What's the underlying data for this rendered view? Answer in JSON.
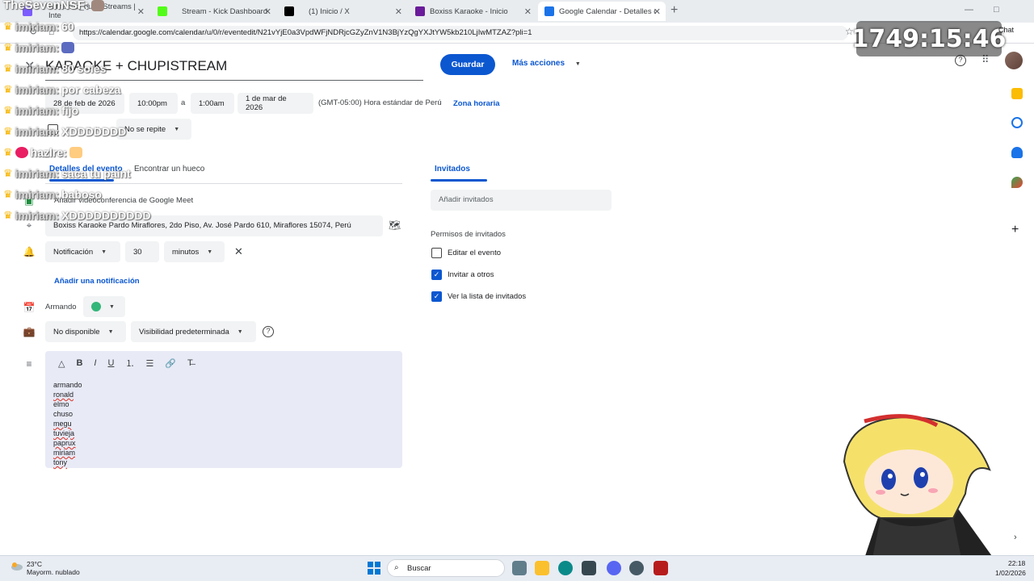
{
  "browser": {
    "tabs": [
      {
        "label": "Armando_ouo | Streams | Inte",
        "color": "#7b5cff"
      },
      {
        "label": "Stream - Kick Dashboard",
        "color": "#53fc18"
      },
      {
        "label": "(1) Inicio / X",
        "color": "#000000"
      },
      {
        "label": "Boxiss Karaoke - Inicio",
        "color": "#6a1b9a"
      },
      {
        "label": "Google Calendar - Detalles del eve",
        "color": "#1a73e8"
      }
    ],
    "url": "https://calendar.google.com/calendar/u/0/r/eventedit/N21vYjE0a3VpdWFjNDRjcGZyZnV1N3BjYzQgYXJtYW5kb210LjIwMTZAZ?pli=1"
  },
  "event": {
    "title": "KARAOKE + CHUPISTREAM",
    "save_label": "Guardar",
    "more_actions_label": "Más acciones",
    "start_date": "28 de feb de 2026",
    "start_time": "10:00pm",
    "to_label": "a",
    "end_time": "1:00am",
    "end_date": "1 de mar de 2026",
    "timezone": "(GMT-05:00) Hora estándar de Perú",
    "timezone_link": "Zona horaria",
    "repeat": "No se repite",
    "all_day_label": "Todo el día"
  },
  "details": {
    "tab_details": "Detalles del evento",
    "tab_find_slot": "Encontrar un hueco",
    "meet_label": "Añadir videoconferencia de Google Meet",
    "location": "Boxiss Karaoke Pardo Miraflores, 2do Piso, Av. José Pardo 610, Miraflores 15074, Perú",
    "notification_type": "Notificación",
    "notification_value": "30",
    "notification_unit": "minutos",
    "add_notification": "Añadir una notificación",
    "calendar_owner": "Armando",
    "calendar_color": "#33b679",
    "availability": "No disponible",
    "visibility": "Visibilidad predeterminada",
    "description_lines": [
      "armando",
      "ronald",
      "elmo",
      "chuso",
      "megu",
      "tuvieja",
      "paprux",
      "miriam",
      "tony"
    ]
  },
  "guests": {
    "tab_label": "Invitados",
    "add_placeholder": "Añadir invitados",
    "permissions_title": "Permisos de invitados",
    "permissions": [
      {
        "label": "Editar el evento",
        "checked": false
      },
      {
        "label": "Invitar a otros",
        "checked": true
      },
      {
        "label": "Ver la lista de invitados",
        "checked": true
      }
    ]
  },
  "overlay": {
    "timer": "1749:15:46",
    "chat_label": "Chat",
    "chat": [
      {
        "user": "TheSevenNSF:",
        "msg": ""
      },
      {
        "user": "imiriam:",
        "msg": "60"
      },
      {
        "user": "imiriam:",
        "msg": ""
      },
      {
        "user": "imiriam:",
        "msg": "80 soles"
      },
      {
        "user": "imiriam:",
        "msg": "por cabeza"
      },
      {
        "user": "imiriam:",
        "msg": "fijo"
      },
      {
        "user": "imiriam:",
        "msg": "XDDDDDDD"
      },
      {
        "user": "hazlre:",
        "msg": ""
      },
      {
        "user": "imiriam:",
        "msg": "saca tu paint"
      },
      {
        "user": "imiriam:",
        "msg": "baboso"
      },
      {
        "user": "imiriam:",
        "msg": "XDDDDDDDDDD"
      }
    ]
  },
  "taskbar": {
    "temp": "23°C",
    "weather": "Mayorm. nublado",
    "search": "Buscar",
    "time": "22:18",
    "date": "1/02/2026"
  }
}
